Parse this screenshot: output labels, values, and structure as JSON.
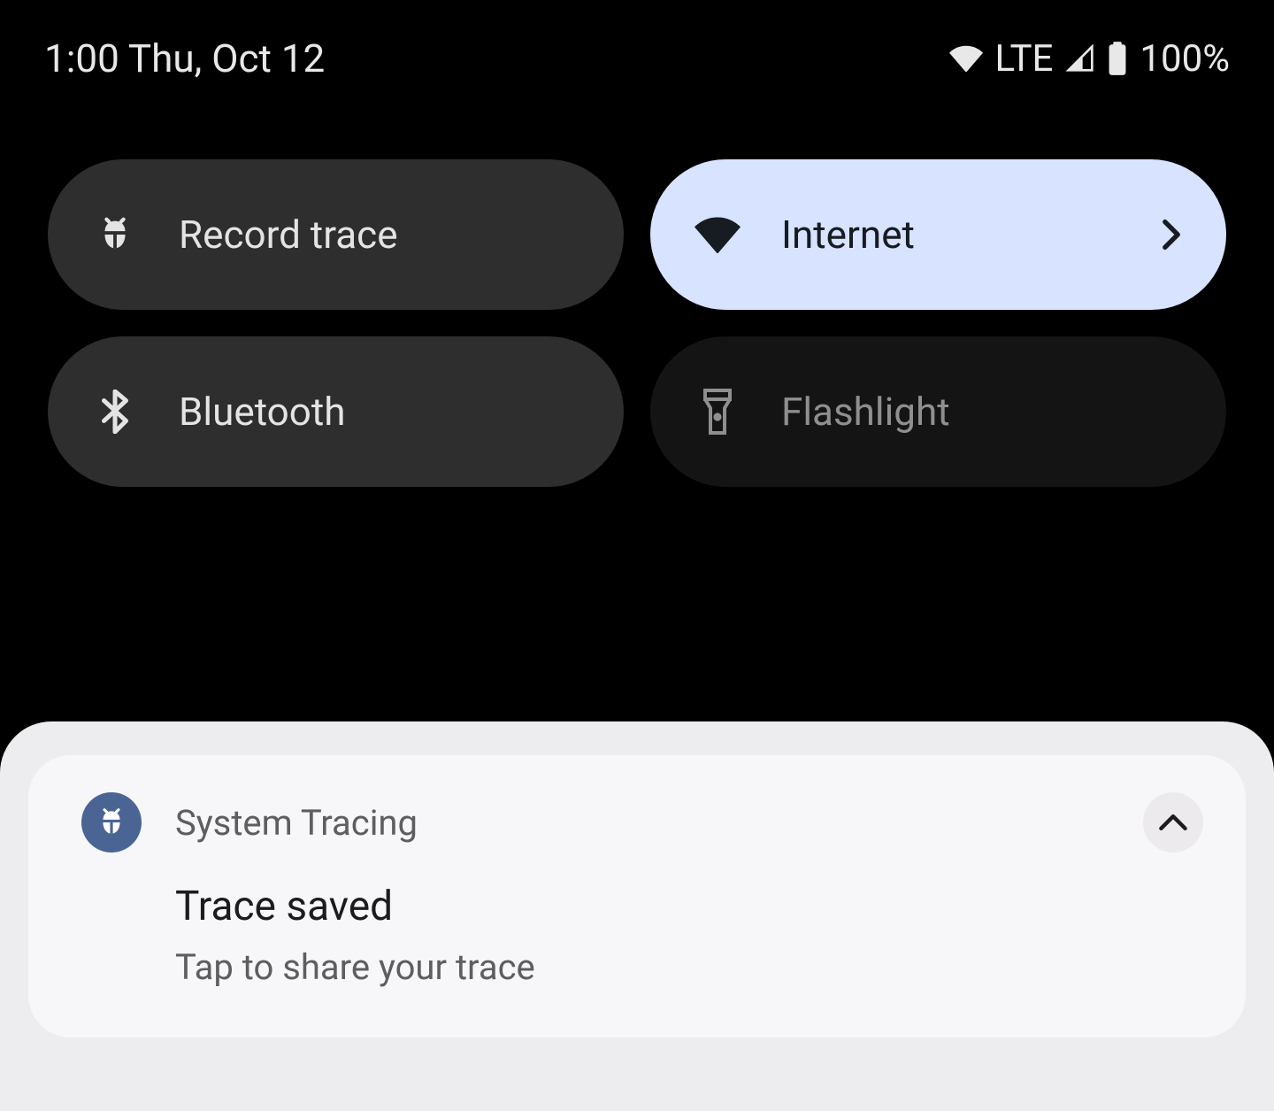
{
  "status": {
    "time_date": "1:00 Thu, Oct 12",
    "network_label": "LTE",
    "battery_percent": "100%"
  },
  "quick_settings": {
    "tiles": [
      {
        "label": "Record trace",
        "icon": "bug-icon",
        "state": "inactive",
        "has_chevron": false
      },
      {
        "label": "Internet",
        "icon": "wifi-icon",
        "state": "active",
        "has_chevron": true
      },
      {
        "label": "Bluetooth",
        "icon": "bluetooth-icon",
        "state": "inactive",
        "has_chevron": false
      },
      {
        "label": "Flashlight",
        "icon": "flashlight-icon",
        "state": "dim",
        "has_chevron": false
      }
    ]
  },
  "notification": {
    "app_name": "System Tracing",
    "title": "Trace saved",
    "text": "Tap to share your trace"
  }
}
